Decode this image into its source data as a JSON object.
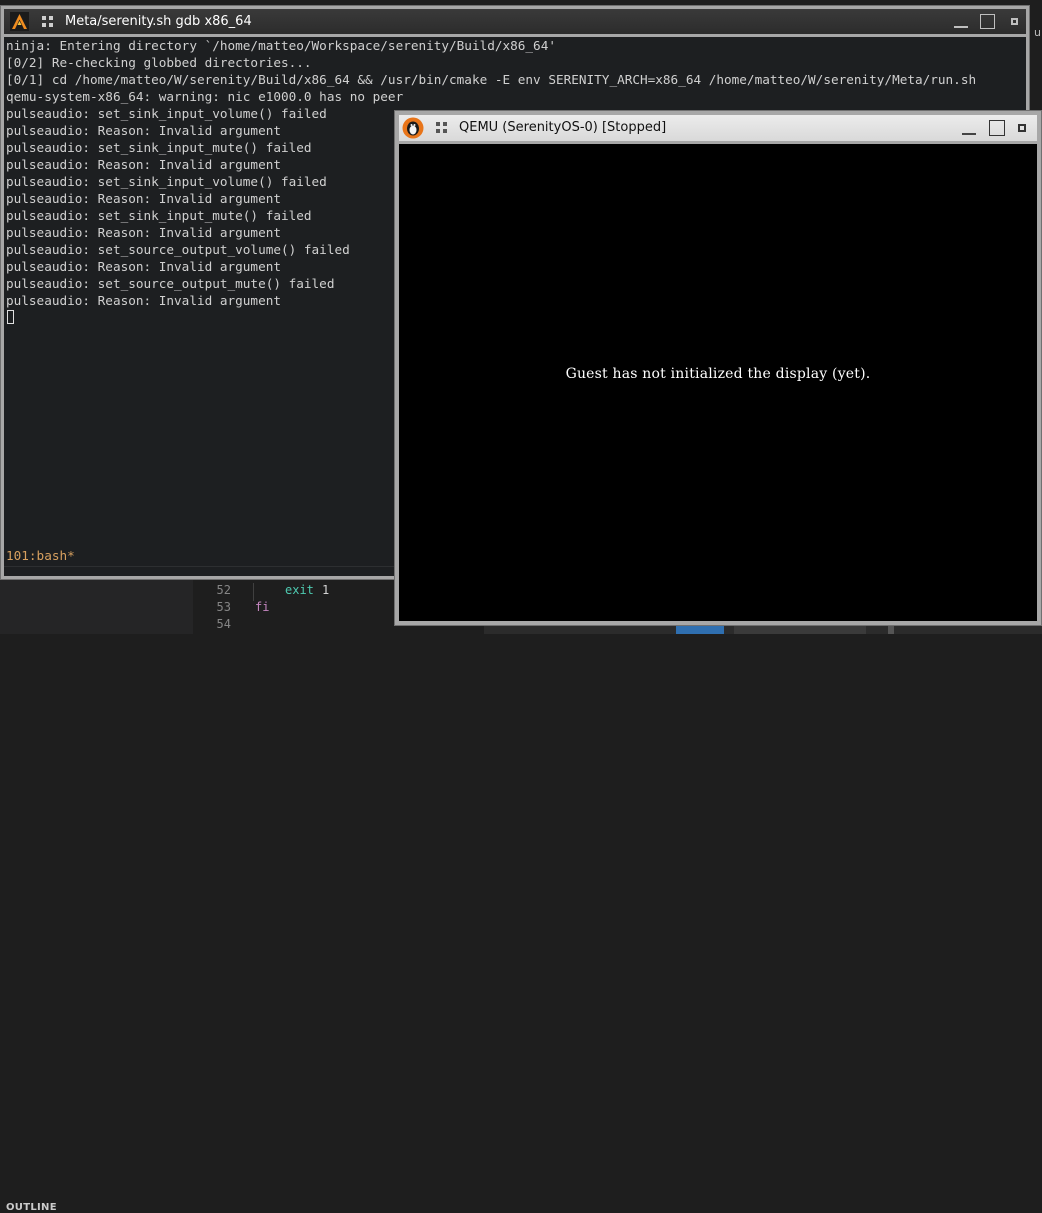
{
  "terminal": {
    "title": "Meta/serenity.sh gdb x86_64",
    "lines": [
      "ninja: Entering directory `/home/matteo/Workspace/serenity/Build/x86_64'",
      "[0/2] Re-checking globbed directories...",
      "[0/1] cd /home/matteo/W/serenity/Build/x86_64 && /usr/bin/cmake -E env SERENITY_ARCH=x86_64 /home/matteo/W/serenity/Meta/run.sh",
      "qemu-system-x86_64: warning: nic e1000.0 has no peer",
      "pulseaudio: set_sink_input_volume() failed",
      "pulseaudio: Reason: Invalid argument",
      "pulseaudio: set_sink_input_mute() failed",
      "pulseaudio: Reason: Invalid argument",
      "pulseaudio: set_sink_input_volume() failed",
      "pulseaudio: Reason: Invalid argument",
      "pulseaudio: set_sink_input_mute() failed",
      "pulseaudio: Reason: Invalid argument",
      "pulseaudio: set_source_output_volume() failed",
      "pulseaudio: Reason: Invalid argument",
      "pulseaudio: set_source_output_mute() failed",
      "pulseaudio: Reason: Invalid argument"
    ],
    "tmux_status": "101:bash*"
  },
  "qemu": {
    "title": "QEMU (SerenityOS-0) [Stopped]",
    "message": "Guest has not initialized the display (yet)."
  },
  "editor": {
    "outline_label": "OUTLINE",
    "gutter": [
      "52",
      "53",
      "54"
    ],
    "code": {
      "line52_keyword": "exit",
      "line52_arg": "1",
      "line53": "fi"
    },
    "right_edge_text": "u"
  },
  "colors": {
    "terminal_bg": "#1d1f21",
    "terminal_fg": "#d0d0d0",
    "tmux_status": "#d7a05f",
    "keyword_exit": "#4ec9b0",
    "keyword_fi": "#c586c0",
    "accent": "#007acc"
  },
  "icons": {
    "terminal_app": "alacritty-icon",
    "qemu_app": "qemu-icon"
  }
}
